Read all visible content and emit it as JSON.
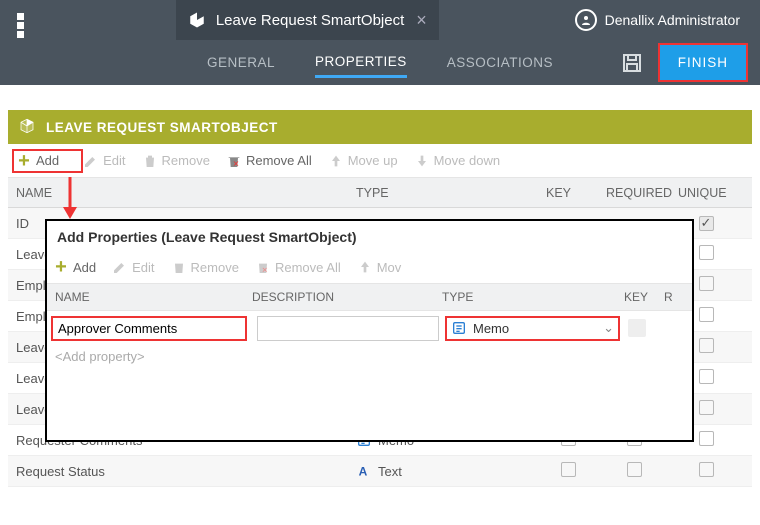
{
  "header": {
    "tab_title": "Leave Request SmartObject",
    "user_name": "Denallix Administrator"
  },
  "subnav": {
    "general": "GENERAL",
    "properties": "PROPERTIES",
    "associations": "ASSOCIATIONS",
    "finish": "FINISH"
  },
  "panel": {
    "title": "LEAVE REQUEST SMARTOBJECT"
  },
  "toolbar": {
    "add": "Add",
    "edit": "Edit",
    "remove": "Remove",
    "remove_all": "Remove All",
    "move_up": "Move up",
    "move_down": "Move down",
    "mov": "Mov"
  },
  "columns": {
    "name": "NAME",
    "type": "TYPE",
    "key": "KEY",
    "required": "REQUIRED",
    "unique": "UNIQUE",
    "description": "DESCRIPTION",
    "field_r": "R"
  },
  "rows": {
    "r0": "ID",
    "r1": "Leave",
    "r2": "Empl",
    "r3": "Empl",
    "r4": "Leave",
    "r5": "Leave",
    "r6": "Leave",
    "r7": "Requester Comments",
    "r7_type": "Memo",
    "r8": "Request Status",
    "r8_type": "Text"
  },
  "modal": {
    "title": "Add Properties (Leave Request SmartObject)",
    "name_value": "Approver Comments",
    "desc_value": "",
    "type_value": "Memo",
    "placeholder": "<Add property>"
  }
}
